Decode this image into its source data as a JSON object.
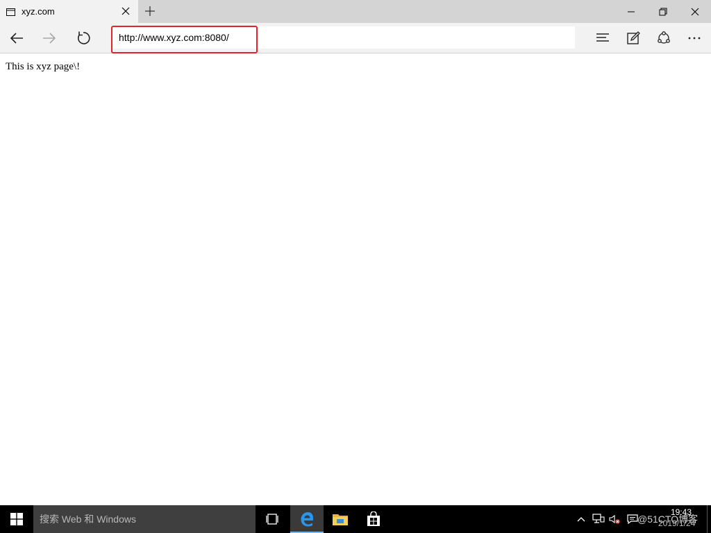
{
  "browser": {
    "tab": {
      "title": "xyz.com"
    },
    "address": {
      "url": "http://www.xyz.com:8080/"
    }
  },
  "page": {
    "body_text": "This is xyz page\\!"
  },
  "taskbar": {
    "search_placeholder": "搜索 Web 和 Windows",
    "clock_time": "19:43",
    "clock_date": "2019/1/24",
    "watermark": "@51CTO博客"
  },
  "icons": {
    "tab": "page-icon",
    "close": "close-icon",
    "new_tab": "plus-icon",
    "back": "arrow-left-icon",
    "forward": "arrow-right-icon",
    "refresh": "refresh-icon",
    "hub": "hub-icon",
    "note": "note-icon",
    "share": "share-icon",
    "more": "more-icon"
  },
  "colors": {
    "highlight": "#e8202a",
    "edge_accent": "#76b9ed",
    "taskbar": "#000000"
  }
}
